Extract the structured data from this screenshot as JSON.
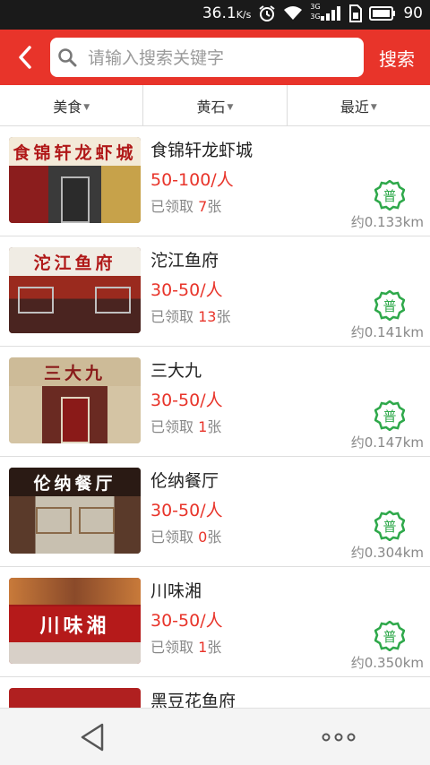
{
  "status_bar": {
    "network_speed": "36.1",
    "speed_unit": "K/s",
    "net_type_a": "3G",
    "net_type_b": "3G",
    "battery": "90"
  },
  "search": {
    "back_icon": "chevron-left-icon",
    "placeholder": "请输入搜索关键字",
    "value": "",
    "button_label": "搜索"
  },
  "filters": [
    {
      "label": "美食"
    },
    {
      "label": "黄石"
    },
    {
      "label": "最近"
    }
  ],
  "restaurants": [
    {
      "sign": "食锦轩龙虾城",
      "name": "食锦轩龙虾城",
      "price": "50-100/人",
      "coupons_prefix": "已领取 ",
      "coupons_count": "7",
      "coupons_suffix": "张",
      "badge": "普",
      "distance": "约0.133km"
    },
    {
      "sign": "沱江鱼府",
      "name": "沱江鱼府",
      "price": "30-50/人",
      "coupons_prefix": "已领取 ",
      "coupons_count": "13",
      "coupons_suffix": "张",
      "badge": "普",
      "distance": "约0.141km"
    },
    {
      "sign": "三大九",
      "name": "三大九",
      "price": "30-50/人",
      "coupons_prefix": "已领取 ",
      "coupons_count": "1",
      "coupons_suffix": "张",
      "badge": "普",
      "distance": "约0.147km"
    },
    {
      "sign": "伦纳餐厅",
      "name": "伦纳餐厅",
      "price": "30-50/人",
      "coupons_prefix": "已领取 ",
      "coupons_count": "0",
      "coupons_suffix": "张",
      "badge": "普",
      "distance": "约0.304km"
    },
    {
      "sign": "川味湘",
      "name": "川味湘",
      "price": "30-50/人",
      "coupons_prefix": "已领取 ",
      "coupons_count": "1",
      "coupons_suffix": "张",
      "badge": "普",
      "distance": "约0.350km"
    },
    {
      "sign": "",
      "name": "黑豆花鱼府"
    }
  ],
  "nav": {
    "back_icon": "triangle-back-icon",
    "more_icon": "more-dots-icon"
  },
  "colors": {
    "brand_red": "#e8342a",
    "badge_green": "#2ea84a"
  }
}
